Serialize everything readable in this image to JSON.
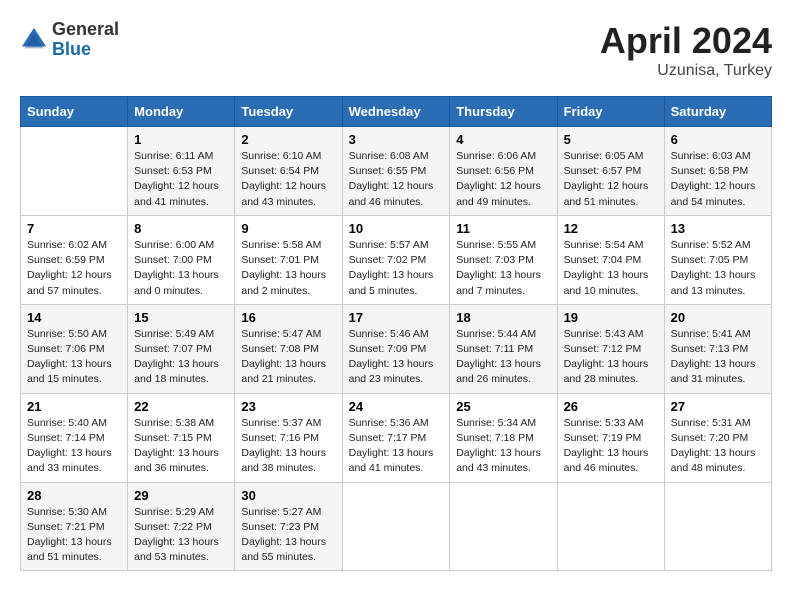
{
  "logo": {
    "general": "General",
    "blue": "Blue"
  },
  "header": {
    "month_year": "April 2024",
    "location": "Uzunisa, Turkey"
  },
  "weekdays": [
    "Sunday",
    "Monday",
    "Tuesday",
    "Wednesday",
    "Thursday",
    "Friday",
    "Saturday"
  ],
  "weeks": [
    [
      {
        "day": "",
        "sunrise": "",
        "sunset": "",
        "daylight": ""
      },
      {
        "day": "1",
        "sunrise": "Sunrise: 6:11 AM",
        "sunset": "Sunset: 6:53 PM",
        "daylight": "Daylight: 12 hours and 41 minutes."
      },
      {
        "day": "2",
        "sunrise": "Sunrise: 6:10 AM",
        "sunset": "Sunset: 6:54 PM",
        "daylight": "Daylight: 12 hours and 43 minutes."
      },
      {
        "day": "3",
        "sunrise": "Sunrise: 6:08 AM",
        "sunset": "Sunset: 6:55 PM",
        "daylight": "Daylight: 12 hours and 46 minutes."
      },
      {
        "day": "4",
        "sunrise": "Sunrise: 6:06 AM",
        "sunset": "Sunset: 6:56 PM",
        "daylight": "Daylight: 12 hours and 49 minutes."
      },
      {
        "day": "5",
        "sunrise": "Sunrise: 6:05 AM",
        "sunset": "Sunset: 6:57 PM",
        "daylight": "Daylight: 12 hours and 51 minutes."
      },
      {
        "day": "6",
        "sunrise": "Sunrise: 6:03 AM",
        "sunset": "Sunset: 6:58 PM",
        "daylight": "Daylight: 12 hours and 54 minutes."
      }
    ],
    [
      {
        "day": "7",
        "sunrise": "Sunrise: 6:02 AM",
        "sunset": "Sunset: 6:59 PM",
        "daylight": "Daylight: 12 hours and 57 minutes."
      },
      {
        "day": "8",
        "sunrise": "Sunrise: 6:00 AM",
        "sunset": "Sunset: 7:00 PM",
        "daylight": "Daylight: 13 hours and 0 minutes."
      },
      {
        "day": "9",
        "sunrise": "Sunrise: 5:58 AM",
        "sunset": "Sunset: 7:01 PM",
        "daylight": "Daylight: 13 hours and 2 minutes."
      },
      {
        "day": "10",
        "sunrise": "Sunrise: 5:57 AM",
        "sunset": "Sunset: 7:02 PM",
        "daylight": "Daylight: 13 hours and 5 minutes."
      },
      {
        "day": "11",
        "sunrise": "Sunrise: 5:55 AM",
        "sunset": "Sunset: 7:03 PM",
        "daylight": "Daylight: 13 hours and 7 minutes."
      },
      {
        "day": "12",
        "sunrise": "Sunrise: 5:54 AM",
        "sunset": "Sunset: 7:04 PM",
        "daylight": "Daylight: 13 hours and 10 minutes."
      },
      {
        "day": "13",
        "sunrise": "Sunrise: 5:52 AM",
        "sunset": "Sunset: 7:05 PM",
        "daylight": "Daylight: 13 hours and 13 minutes."
      }
    ],
    [
      {
        "day": "14",
        "sunrise": "Sunrise: 5:50 AM",
        "sunset": "Sunset: 7:06 PM",
        "daylight": "Daylight: 13 hours and 15 minutes."
      },
      {
        "day": "15",
        "sunrise": "Sunrise: 5:49 AM",
        "sunset": "Sunset: 7:07 PM",
        "daylight": "Daylight: 13 hours and 18 minutes."
      },
      {
        "day": "16",
        "sunrise": "Sunrise: 5:47 AM",
        "sunset": "Sunset: 7:08 PM",
        "daylight": "Daylight: 13 hours and 21 minutes."
      },
      {
        "day": "17",
        "sunrise": "Sunrise: 5:46 AM",
        "sunset": "Sunset: 7:09 PM",
        "daylight": "Daylight: 13 hours and 23 minutes."
      },
      {
        "day": "18",
        "sunrise": "Sunrise: 5:44 AM",
        "sunset": "Sunset: 7:11 PM",
        "daylight": "Daylight: 13 hours and 26 minutes."
      },
      {
        "day": "19",
        "sunrise": "Sunrise: 5:43 AM",
        "sunset": "Sunset: 7:12 PM",
        "daylight": "Daylight: 13 hours and 28 minutes."
      },
      {
        "day": "20",
        "sunrise": "Sunrise: 5:41 AM",
        "sunset": "Sunset: 7:13 PM",
        "daylight": "Daylight: 13 hours and 31 minutes."
      }
    ],
    [
      {
        "day": "21",
        "sunrise": "Sunrise: 5:40 AM",
        "sunset": "Sunset: 7:14 PM",
        "daylight": "Daylight: 13 hours and 33 minutes."
      },
      {
        "day": "22",
        "sunrise": "Sunrise: 5:38 AM",
        "sunset": "Sunset: 7:15 PM",
        "daylight": "Daylight: 13 hours and 36 minutes."
      },
      {
        "day": "23",
        "sunrise": "Sunrise: 5:37 AM",
        "sunset": "Sunset: 7:16 PM",
        "daylight": "Daylight: 13 hours and 38 minutes."
      },
      {
        "day": "24",
        "sunrise": "Sunrise: 5:36 AM",
        "sunset": "Sunset: 7:17 PM",
        "daylight": "Daylight: 13 hours and 41 minutes."
      },
      {
        "day": "25",
        "sunrise": "Sunrise: 5:34 AM",
        "sunset": "Sunset: 7:18 PM",
        "daylight": "Daylight: 13 hours and 43 minutes."
      },
      {
        "day": "26",
        "sunrise": "Sunrise: 5:33 AM",
        "sunset": "Sunset: 7:19 PM",
        "daylight": "Daylight: 13 hours and 46 minutes."
      },
      {
        "day": "27",
        "sunrise": "Sunrise: 5:31 AM",
        "sunset": "Sunset: 7:20 PM",
        "daylight": "Daylight: 13 hours and 48 minutes."
      }
    ],
    [
      {
        "day": "28",
        "sunrise": "Sunrise: 5:30 AM",
        "sunset": "Sunset: 7:21 PM",
        "daylight": "Daylight: 13 hours and 51 minutes."
      },
      {
        "day": "29",
        "sunrise": "Sunrise: 5:29 AM",
        "sunset": "Sunset: 7:22 PM",
        "daylight": "Daylight: 13 hours and 53 minutes."
      },
      {
        "day": "30",
        "sunrise": "Sunrise: 5:27 AM",
        "sunset": "Sunset: 7:23 PM",
        "daylight": "Daylight: 13 hours and 55 minutes."
      },
      {
        "day": "",
        "sunrise": "",
        "sunset": "",
        "daylight": ""
      },
      {
        "day": "",
        "sunrise": "",
        "sunset": "",
        "daylight": ""
      },
      {
        "day": "",
        "sunrise": "",
        "sunset": "",
        "daylight": ""
      },
      {
        "day": "",
        "sunrise": "",
        "sunset": "",
        "daylight": ""
      }
    ]
  ]
}
